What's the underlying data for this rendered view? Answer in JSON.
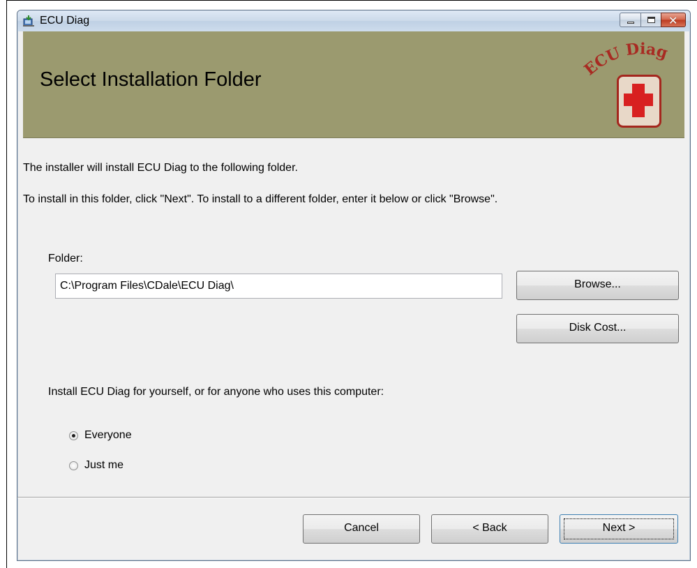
{
  "window": {
    "title": "ECU Diag",
    "icon": "installer-icon",
    "controls": [
      "minimize-icon",
      "maximize-icon",
      "close-icon"
    ]
  },
  "banner": {
    "title": "Select Installation Folder",
    "logo_text": "ECU Diag",
    "logo_icon": "red-cross-icon"
  },
  "intro": {
    "line1": "The installer will install ECU Diag to the following folder.",
    "line2": "To install in this folder, click \"Next\". To install to a different folder, enter it below or click \"Browse\"."
  },
  "folder": {
    "label": "Folder:",
    "value": "C:\\Program Files\\CDale\\ECU Diag\\"
  },
  "buttons": {
    "browse": "Browse...",
    "disk_cost": "Disk Cost...",
    "cancel": "Cancel",
    "back": "< Back",
    "next": "Next >"
  },
  "install_for": {
    "prompt": "Install ECU Diag for yourself, or for anyone who uses this computer:",
    "options": [
      {
        "label": "Everyone",
        "selected": true
      },
      {
        "label": "Just me",
        "selected": false
      }
    ]
  }
}
